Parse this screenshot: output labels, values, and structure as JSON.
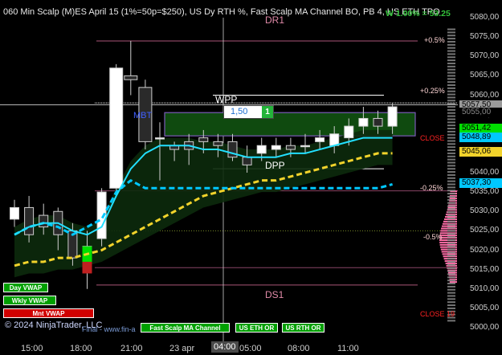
{
  "window": {
    "title": "060 Min Scalp (M)ES April 15 (1%=50p=$250), US Dy RTH %, Fast Scalp MA Channel BO, PB 4, US ETH TPO",
    "performance": "W 1.00% = 53.25",
    "copyright": "© 2024 NinjaTrader, LLC",
    "footer_note": "Final - www.fin-a"
  },
  "colors": {
    "background": "#000000",
    "accent_green": "#00e000",
    "price_cyan": "#00c8ff",
    "vwap_yellow": "#f2d32b",
    "volume_profile": "#ff6ea8"
  },
  "labels": {
    "dr1": "DR1",
    "ds1": "DS1",
    "wpp": "WPP",
    "dpp": "DPP",
    "mbt": "MBT",
    "pct_plus_05": "+0.5%",
    "pct_plus_025": "+0.25%",
    "pct_minus_025": "-0.25%",
    "pct_minus_05": "-0.5%",
    "close_mid": "CLOSE",
    "close_bottom": "CLOSE 19"
  },
  "order": {
    "quantity": "1,50",
    "button_label": "1"
  },
  "price_axis": {
    "labels": [
      "5080,00",
      "5075,00",
      "5070,00",
      "5065,00",
      "5060,00",
      "5055,00",
      "5050,00",
      "5045,00",
      "5040,00",
      "5035,00",
      "5030,00",
      "5025,00",
      "5020,00",
      "5015,00",
      "5010,00",
      "5005,00",
      "5000,00"
    ],
    "markers": [
      {
        "label": "5057,50",
        "price": 5057.5,
        "bg": "#9a9a9a",
        "fg": "#000000"
      },
      {
        "label": "5055,00",
        "price": 5055.6,
        "bg": "#000000",
        "fg": "#888888"
      },
      {
        "label": "5051,42",
        "price": 5051.4,
        "bg": "#00e000",
        "fg": "#000000"
      },
      {
        "label": "5048,89",
        "price": 5049.1,
        "bg": "#00c8ff",
        "fg": "#000000"
      },
      {
        "label": "5045,06",
        "price": 5045.4,
        "bg": "#f2d32b",
        "fg": "#000000"
      },
      {
        "label": "5037,30",
        "price": 5037.3,
        "bg": "#00c8ff",
        "fg": "#000000"
      }
    ]
  },
  "time_axis": {
    "labels": [
      "15:00",
      "18:00",
      "21:00",
      "23 apr",
      "04:00",
      "05:00",
      "08:00",
      "11:00"
    ],
    "selected": "04:00"
  },
  "legend_badges": [
    {
      "label": "Day VWAP",
      "bg": "#00a000"
    },
    {
      "label": "Wkly VWAP",
      "bg": "#00a000"
    },
    {
      "label": "Mnt VWAP",
      "bg": "#d00000"
    },
    {
      "label": "Fast Scalp MA Channel",
      "bg": "#00a000"
    },
    {
      "label": "US ETH OR",
      "bg": "#00a000"
    },
    {
      "label": "US RTH OR",
      "bg": "#00a000"
    }
  ],
  "chart_data": {
    "type": "candlestick",
    "price_range": [
      5000,
      5082
    ],
    "candles": [
      {
        "o": 5028,
        "h": 5033,
        "l": 5026,
        "c": 5031
      },
      {
        "o": 5031,
        "h": 5034,
        "l": 5022,
        "c": 5024
      },
      {
        "o": 5029,
        "h": 5032,
        "l": 5024,
        "c": 5026
      },
      {
        "o": 5030,
        "h": 5031,
        "l": 5020,
        "c": 5024
      },
      {
        "o": 5025,
        "h": 5027,
        "l": 5016,
        "c": 5018
      },
      {
        "o": 5021,
        "h": 5025,
        "l": 5010,
        "c": 5015
      },
      {
        "o": 5023,
        "h": 5036,
        "l": 5021,
        "c": 5035
      },
      {
        "o": 5036,
        "h": 5068,
        "l": 5035,
        "c": 5067
      },
      {
        "o": 5065,
        "h": 5074,
        "l": 5060,
        "c": 5064
      },
      {
        "o": 5062,
        "h": 5064,
        "l": 5046,
        "c": 5048
      },
      {
        "o": 5049,
        "h": 5053,
        "l": 5038,
        "c": 5049
      },
      {
        "o": 5047,
        "h": 5048,
        "l": 5043,
        "c": 5046
      },
      {
        "o": 5048,
        "h": 5050,
        "l": 5042,
        "c": 5046
      },
      {
        "o": 5049,
        "h": 5051,
        "l": 5045,
        "c": 5048
      },
      {
        "o": 5048,
        "h": 5050,
        "l": 5044,
        "c": 5047
      },
      {
        "o": 5048,
        "h": 5050,
        "l": 5043,
        "c": 5044
      },
      {
        "o": 5044,
        "h": 5047,
        "l": 5040,
        "c": 5042
      },
      {
        "o": 5045,
        "h": 5049,
        "l": 5043,
        "c": 5047
      },
      {
        "o": 5046,
        "h": 5049,
        "l": 5044,
        "c": 5047
      },
      {
        "o": 5047,
        "h": 5049,
        "l": 5044,
        "c": 5046
      },
      {
        "o": 5047,
        "h": 5050,
        "l": 5045,
        "c": 5047
      },
      {
        "o": 5048,
        "h": 5051,
        "l": 5046,
        "c": 5049
      },
      {
        "o": 5047,
        "h": 5052,
        "l": 5045,
        "c": 5050
      },
      {
        "o": 5049,
        "h": 5054,
        "l": 5047,
        "c": 5052
      },
      {
        "o": 5052,
        "h": 5057,
        "l": 5050,
        "c": 5054
      },
      {
        "o": 5054,
        "h": 5056,
        "l": 5050,
        "c": 5052
      },
      {
        "o": 5052,
        "h": 5058,
        "l": 5050,
        "c": 5057
      }
    ],
    "series": [
      {
        "name": "Day VWAP",
        "values": [
          5024,
          5026,
          5027,
          5026,
          5024,
          5026,
          5028,
          5035,
          5038,
          5036,
          5036,
          5036,
          5036,
          5036,
          5036,
          5036,
          5036,
          5036,
          5036,
          5036,
          5036,
          5036,
          5036,
          5036,
          5036,
          5036,
          5037
        ]
      },
      {
        "name": "Wkly VWAP",
        "values": [
          5016,
          5017,
          5017,
          5018,
          5018,
          5019,
          5020,
          5022,
          5024,
          5026,
          5028,
          5030,
          5032,
          5034,
          5035,
          5036,
          5037,
          5038,
          5038,
          5039,
          5040,
          5041,
          5042,
          5043,
          5044,
          5045,
          5045
        ]
      },
      {
        "name": "Fast Scalp MA Channel",
        "values": [
          5024,
          5026,
          5027,
          5027,
          5025,
          5024,
          5026,
          5034,
          5041,
          5045,
          5047,
          5047,
          5047,
          5046,
          5046,
          5045,
          5044,
          5044,
          5044,
          5045,
          5045,
          5046,
          5047,
          5048,
          5049,
          5049,
          5049
        ]
      }
    ]
  }
}
